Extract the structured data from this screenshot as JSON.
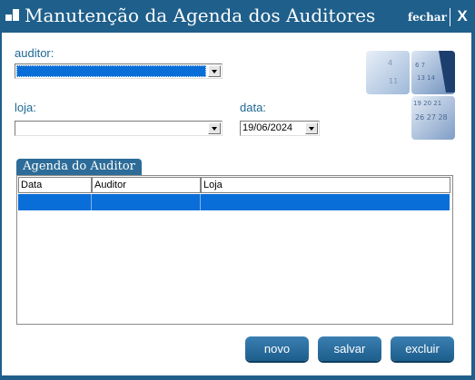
{
  "window": {
    "title": "Manutenção da Agenda dos Auditores",
    "close_label": "fechar",
    "close_glyph": "X"
  },
  "form": {
    "auditor_label": "auditor:",
    "auditor_value": "",
    "loja_label": "loja:",
    "loja_value": "",
    "data_label": "data:",
    "data_value": "19/06/2024"
  },
  "agenda": {
    "tab_label": "Agenda do Auditor",
    "columns": [
      "Data",
      "Auditor",
      "Loja"
    ],
    "rows": [
      [
        "",
        "",
        ""
      ]
    ]
  },
  "buttons": {
    "novo": "novo",
    "salvar": "salvar",
    "excluir": "excluir"
  },
  "colors": {
    "frame": "#1f5f8b",
    "accent": "#1e6894",
    "selection": "#0a6ed8"
  }
}
